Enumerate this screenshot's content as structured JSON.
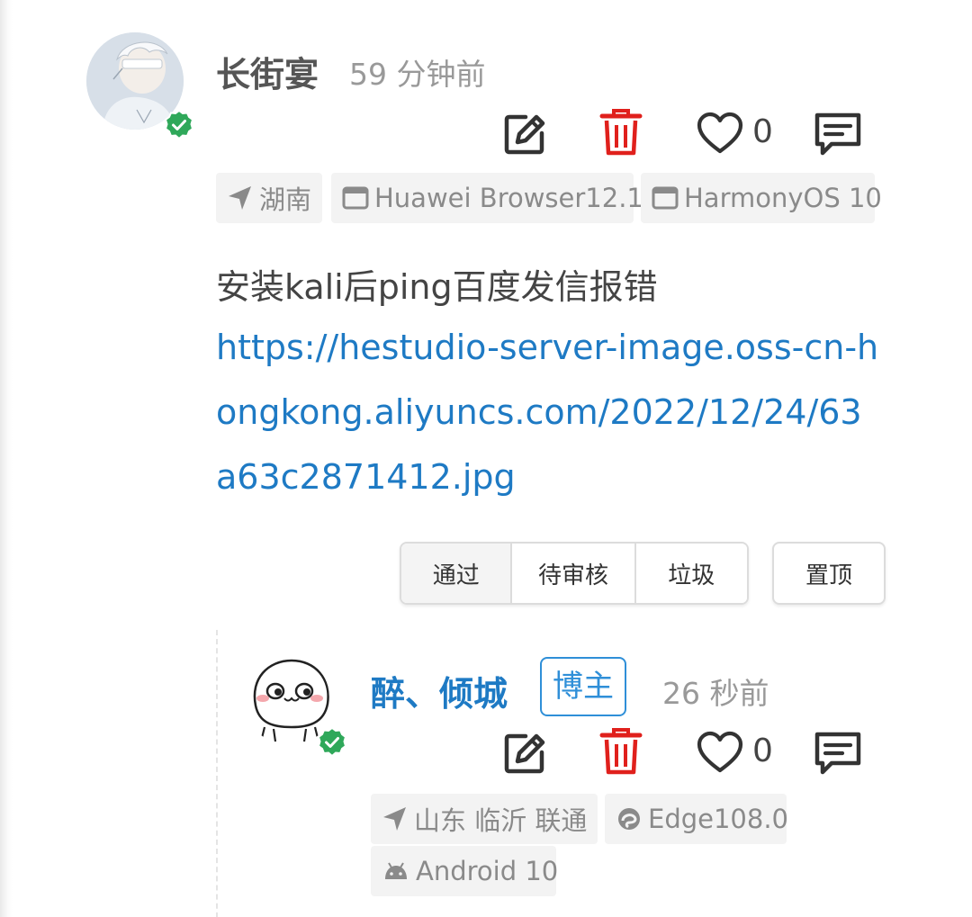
{
  "comment": {
    "author": "长街宴",
    "time": "59 分钟前",
    "like_count": "0",
    "tags": {
      "location": "湖南",
      "browser": "Huawei Browser12.1",
      "os": "HarmonyOS 10"
    },
    "text": "安装kali后ping百度发信报错",
    "link": "https://hestudio-server-image.oss-cn-hongkong.aliyuncs.com/2022/12/24/63a63c2871412.jpg",
    "moderation": {
      "approve": "通过",
      "pending": "待审核",
      "spam": "垃圾",
      "pin": "置顶"
    }
  },
  "reply": {
    "author": "醉、倾城",
    "badge": "博主",
    "time": "26 秒前",
    "like_count": "0",
    "tags": {
      "location": "山东 临沂 联通",
      "browser": "Edge108.0",
      "os": "Android 10"
    }
  },
  "colors": {
    "author_name": "#555555",
    "owner_name": "#1e7ac4",
    "link": "#1e7ac4",
    "delete": "#e0201c",
    "verified": "#2fa85a",
    "tag_bg": "#f3f3f3"
  },
  "icons": {
    "edit": "edit-icon",
    "delete": "trash-icon",
    "like": "heart-icon",
    "reply": "comment-icon",
    "location": "location-arrow-icon",
    "browser": "browser-window-icon",
    "os": "os-window-icon",
    "edge": "edge-icon",
    "android": "android-icon",
    "verified": "verified-badge-icon"
  }
}
